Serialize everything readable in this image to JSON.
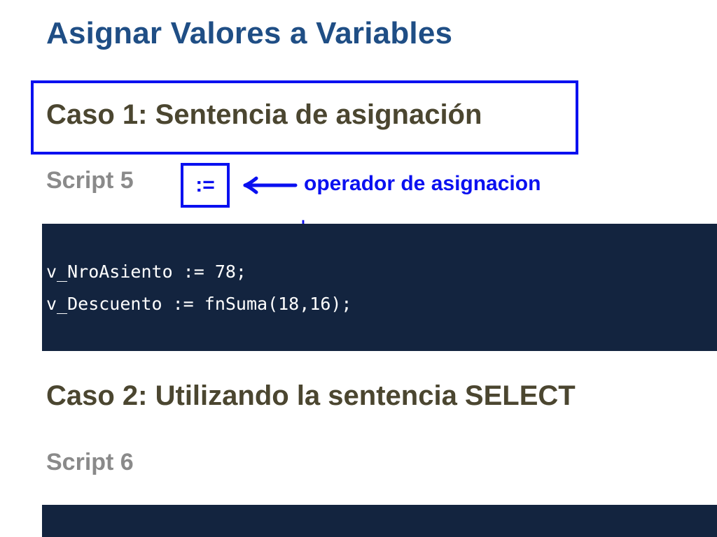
{
  "page": {
    "title": "Asignar Valores a Variables"
  },
  "case1": {
    "heading": "Caso 1: Sentencia de asignación",
    "script_label": "Script 5",
    "operator_symbol": ":=",
    "annotation": "operador de asignacion",
    "plus_mark": "+",
    "code_lines": [
      "v_NroAsiento := 78;",
      "v_Descuento := fnSuma(18,16);"
    ]
  },
  "case2": {
    "heading": "Caso 2: Utilizando la sentencia SELECT",
    "script_label": "Script 6"
  },
  "colors": {
    "title": "#1f4e85",
    "heading": "#4b4630",
    "script_label": "#8a8a8a",
    "annotation": "#0a10f0",
    "code_background": "#13243f",
    "code_text": "#ffffff"
  },
  "icons": {
    "arrow": "arrow-left-icon"
  }
}
